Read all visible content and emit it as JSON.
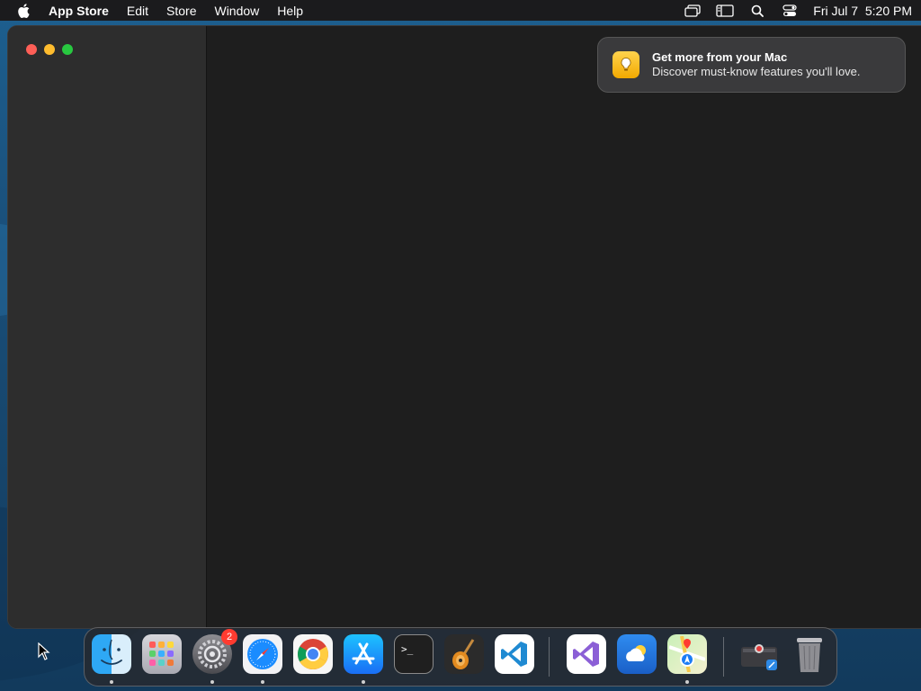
{
  "menubar": {
    "app_name": "App Store",
    "menus": [
      "Edit",
      "Store",
      "Window",
      "Help"
    ],
    "clock": "Fri Jul 7  5:20 PM",
    "status_icons": [
      "screen-mirroring-icon",
      "display-icon",
      "spotlight-search-icon",
      "control-center-icon"
    ]
  },
  "notification": {
    "title": "Get more from your Mac",
    "body": "Discover must-know features you'll love.",
    "icon": "lightbulb-icon"
  },
  "dock": {
    "items": [
      {
        "name": "finder",
        "running": true
      },
      {
        "name": "launchpad",
        "running": false
      },
      {
        "name": "system-settings",
        "running": true,
        "badge": "2"
      },
      {
        "name": "safari",
        "running": true
      },
      {
        "name": "chrome",
        "running": false
      },
      {
        "name": "app-store",
        "running": true
      },
      {
        "name": "terminal",
        "running": false
      },
      {
        "name": "garageband",
        "running": false
      },
      {
        "name": "vscode",
        "running": false
      },
      {
        "name": "visual-studio",
        "running": false
      },
      {
        "name": "weather",
        "running": false
      },
      {
        "name": "maps",
        "running": true
      },
      {
        "name": "downloads-stack",
        "running": false
      },
      {
        "name": "trash",
        "running": false
      }
    ]
  },
  "colors": {
    "menubar_bg": "#1b1b1d",
    "window_bg": "#1e1e1e",
    "sidebar_bg": "#2d2d2d",
    "close": "#fe5f57",
    "minimize": "#febc2e",
    "maximize": "#28c840",
    "badge": "#ff3b30"
  }
}
